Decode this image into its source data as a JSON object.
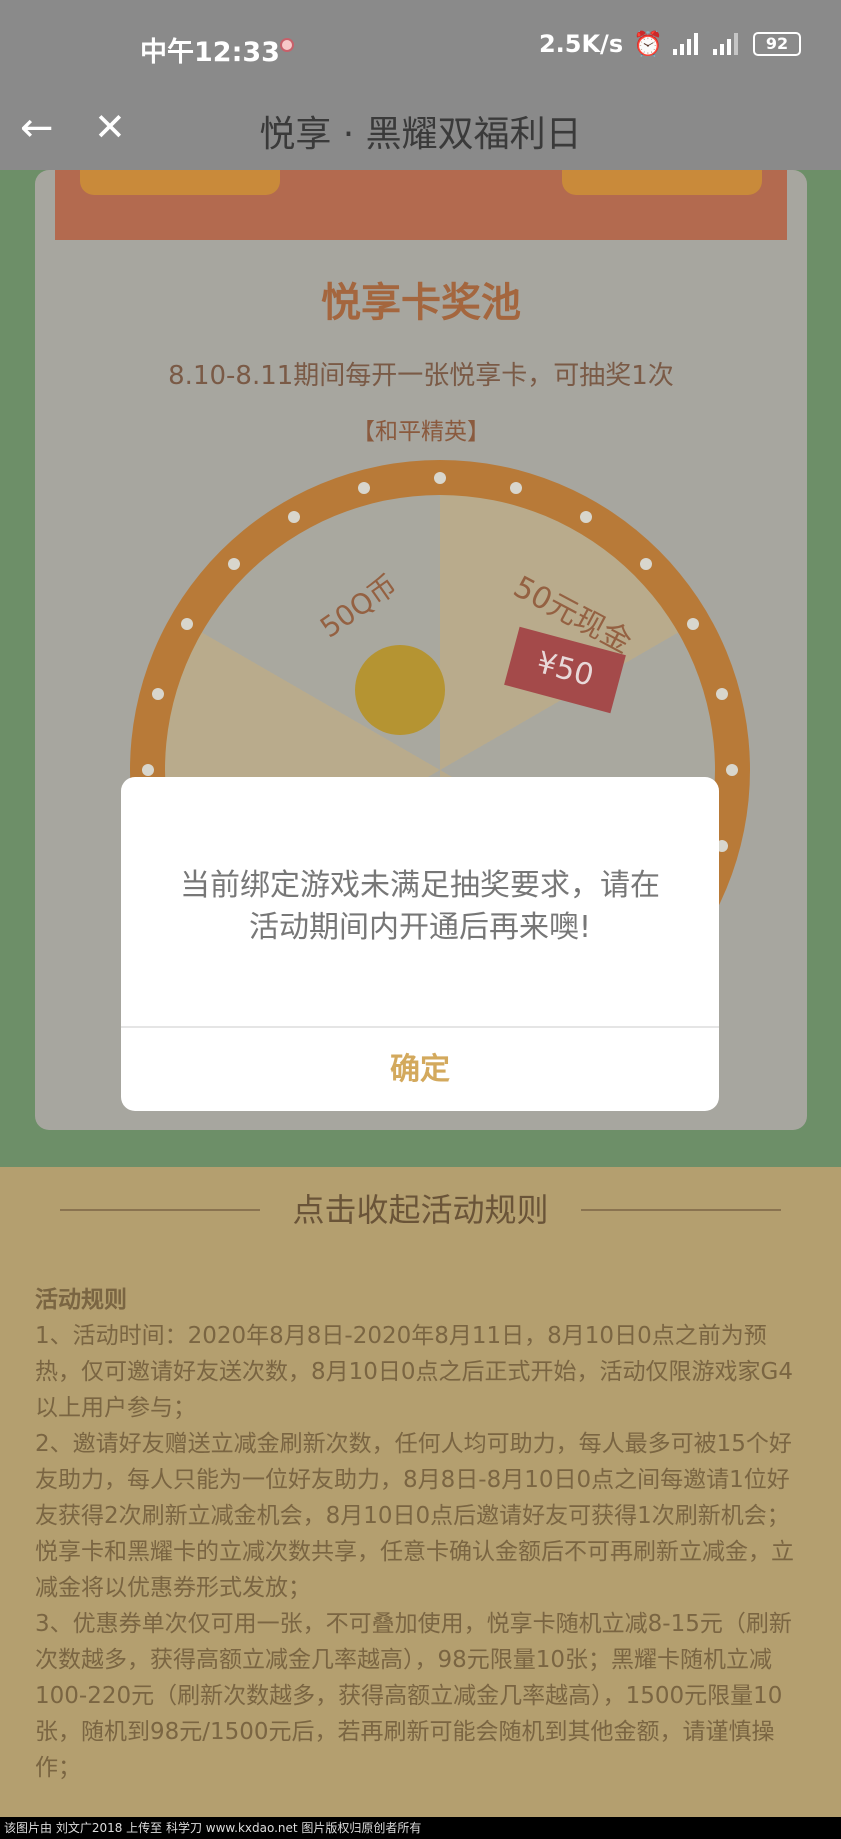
{
  "status_bar": {
    "time": "中午12:33",
    "network_speed": "2.5K/s",
    "battery": "92"
  },
  "nav": {
    "title": "悦享 · 黑耀双福利日",
    "back_icon": "arrow-left-icon",
    "close_icon": "close-icon"
  },
  "card": {
    "title": "悦享卡奖池",
    "desc": "8.10-8.11期间每开一张悦享卡，可抽奖1次",
    "game": "【和平精英】",
    "prizes": [
      "50Q币",
      "50元现金",
      "¥50"
    ]
  },
  "rules": {
    "toggle": "点击收起活动规则",
    "heading": "活动规则",
    "lines": [
      "1、活动时间：2020年8月8日-2020年8月11日，8月10日0点之前为预热，仅可邀请好友送次数，8月10日0点之后正式开始，活动仅限游戏家G4以上用户参与；",
      "2、邀请好友赠送立减金刷新次数，任何人均可助力，每人最多可被15个好友助力，每人只能为一位好友助力，8月8日-8月10日0点之间每邀请1位好友获得2次刷新立减金机会，8月10日0点后邀请好友可获得1次刷新机会；悦享卡和黑耀卡的立减次数共享，任意卡确认金额后不可再刷新立减金，立减金将以优惠券形式发放；",
      "3、优惠券单次仅可用一张，不可叠加使用，悦享卡随机立减8-15元（刷新次数越多，获得高额立减金几率越高），98元限量10张；黑耀卡随机立减100-220元（刷新次数越多，获得高额立减金几率越高），1500元限量10张，随机到98元/1500元后，若再刷新可能会随机到其他金额，请谨慎操作；"
    ]
  },
  "dialog": {
    "message": "当前绑定游戏未满足抽奖要求，请在活动期间内开通后再来噢!",
    "confirm": "确定"
  },
  "watermark": "该图片由 刘文广2018 上传至 科学刀 www.kxdao.net 图片版权归原创者所有"
}
